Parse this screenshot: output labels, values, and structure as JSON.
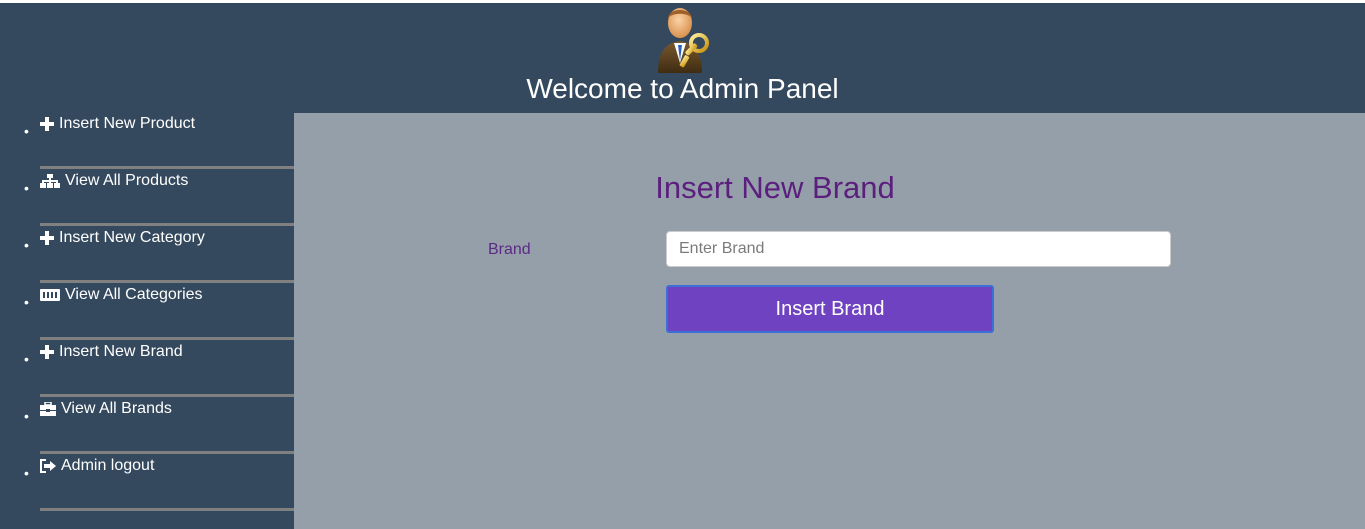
{
  "header": {
    "title": "Welcome to Admin Panel",
    "avatar_icon": "admin-user-with-key-icon"
  },
  "sidebar": {
    "items": [
      {
        "label": "Insert New Product",
        "icon": "plus-icon"
      },
      {
        "label": "View All Products",
        "icon": "sitemap-icon"
      },
      {
        "label": "Insert New Category",
        "icon": "plus-icon"
      },
      {
        "label": "View All Categories",
        "icon": "ticket-icon"
      },
      {
        "label": "Insert New Brand",
        "icon": "plus-icon"
      },
      {
        "label": "View All Brands",
        "icon": "toolbox-icon"
      },
      {
        "label": "Admin logout",
        "icon": "sign-out-icon"
      }
    ]
  },
  "main": {
    "heading": "Insert New Brand",
    "brand_label": "Brand",
    "brand_placeholder": "Enter Brand",
    "brand_value": "",
    "submit_label": "Insert Brand"
  },
  "colors": {
    "header_bg": "#34495e",
    "sidebar_bg": "#34495e",
    "main_bg": "#959fa9",
    "heading_color": "#5b1f7e",
    "button_bg": "#6f42c1",
    "button_border": "#3d6fd8"
  }
}
